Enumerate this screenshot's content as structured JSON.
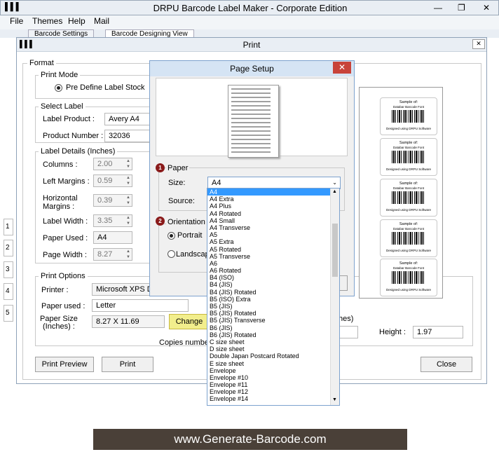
{
  "app": {
    "title": "DRPU Barcode Label Maker - Corporate Edition",
    "menu": [
      "File",
      "Themes",
      "Help",
      "Mail"
    ],
    "tabs": [
      "Barcode Settings",
      "Barcode Designing View"
    ]
  },
  "print": {
    "title": "Print",
    "format_label": "Format",
    "print_mode": {
      "label": "Print Mode",
      "option": "Pre Define Label Stock"
    },
    "select_label": {
      "label": "Select Label",
      "label_product_caption": "Label Product :",
      "label_product_value": "Avery A4",
      "product_number_caption": "Product Number :",
      "product_number_value": "32036"
    },
    "label_details": {
      "label": "Label Details (Inches)",
      "columns_caption": "Columns :",
      "columns_value": "2.00",
      "left_margins_caption": "Left Margins :",
      "left_margins_value": "0.59",
      "horizontal_margins_caption_1": "Horizontal",
      "horizontal_margins_caption_2": "Margins :",
      "horizontal_margins_value": "0.39",
      "label_width_caption": "Label Width :",
      "label_width_value": "3.35",
      "paper_used_caption": "Paper Used :",
      "paper_used_value": "A4",
      "page_width_caption": "Page Width :",
      "page_width_value": "8.27"
    },
    "print_options": {
      "label": "Print Options",
      "printer_caption": "Printer :",
      "printer_value": "Microsoft XPS Docum",
      "paper_used_caption": "Paper used :",
      "paper_used_value": "Letter",
      "paper_size_caption_1": "Paper Size",
      "paper_size_caption_2": "(Inches) :",
      "paper_size_value": "8.27 X 11.69",
      "change_button": "Change",
      "copies_caption": "Copies number",
      "inches_suffix": "hes)",
      "height_caption": "Height :",
      "height_value": "1.97"
    },
    "buttons": {
      "print_preview": "Print Preview",
      "print": "Print",
      "close": "Close"
    },
    "row_numbers": [
      "1",
      "2",
      "3",
      "4",
      "5"
    ],
    "label_preview": {
      "line1": "Sample of:",
      "line2": "Databar Barcode Font",
      "line3": "Designed using DRPU Software"
    }
  },
  "page_setup": {
    "title": "Page Setup",
    "paper_badge": "1",
    "paper_label": "Paper",
    "size_caption": "Size:",
    "size_value": "A4",
    "source_caption": "Source:",
    "orientation_badge": "2",
    "orientation_label": "Orientation",
    "portrait": "Portrait",
    "landscape": "Landscape",
    "size_options": [
      "A4",
      "A4 Extra",
      "A4 Plus",
      "A4 Rotated",
      "A4 Small",
      "A4 Transverse",
      "A5",
      "A5 Extra",
      "A5 Rotated",
      "A5 Transverse",
      "A6",
      "A6 Rotated",
      "B4 (ISO)",
      "B4 (JIS)",
      "B4 (JIS) Rotated",
      "B5 (ISO) Extra",
      "B5 (JIS)",
      "B5 (JIS) Rotated",
      "B5 (JIS) Transverse",
      "B6 (JIS)",
      "B6 (JIS) Rotated",
      "C size sheet",
      "D size sheet",
      "Double Japan Postcard Rotated",
      "E size sheet",
      "Envelope",
      "Envelope #10",
      "Envelope #11",
      "Envelope #12",
      "Envelope #14"
    ]
  },
  "footer": "www.Generate-Barcode.com"
}
